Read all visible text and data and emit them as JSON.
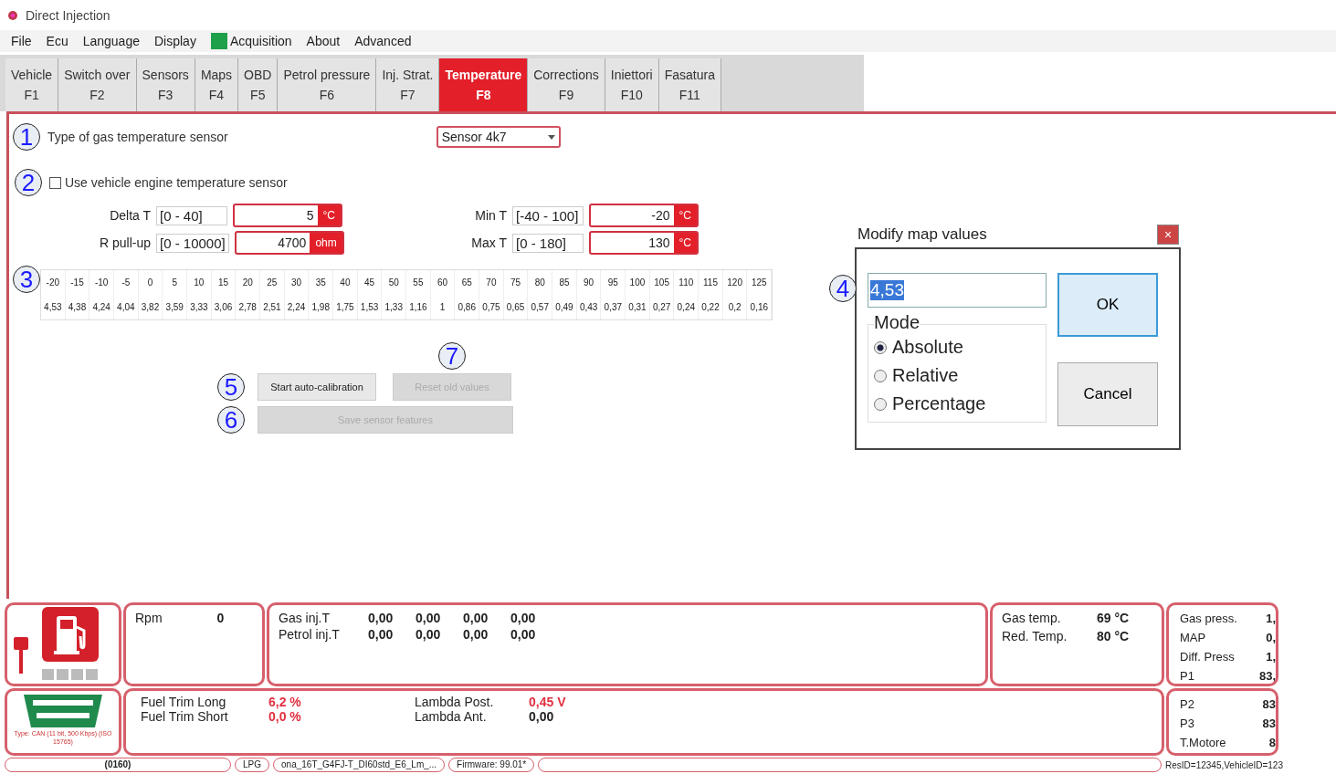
{
  "window": {
    "title": "Direct Injection"
  },
  "menu": [
    {
      "label": "File",
      "indicator": false
    },
    {
      "label": "Ecu",
      "indicator": false
    },
    {
      "label": "Language",
      "indicator": false
    },
    {
      "label": "Display",
      "indicator": false
    },
    {
      "label": "Acquisition",
      "indicator": true
    },
    {
      "label": "About",
      "indicator": false
    },
    {
      "label": "Advanced",
      "indicator": false
    }
  ],
  "tabs": [
    {
      "label": "Vehicle",
      "key": "F1",
      "selected": false
    },
    {
      "label": "Switch over",
      "key": "F2",
      "selected": false
    },
    {
      "label": "Sensors",
      "key": "F3",
      "selected": false
    },
    {
      "label": "Maps",
      "key": "F4",
      "selected": false
    },
    {
      "label": "OBD",
      "key": "F5",
      "selected": false
    },
    {
      "label": "Petrol pressure",
      "key": "F6",
      "selected": false
    },
    {
      "label": "Inj. Strat.",
      "key": "F7",
      "selected": false
    },
    {
      "label": "Temperature",
      "key": "F8",
      "selected": true
    },
    {
      "label": "Corrections",
      "key": "F9",
      "selected": false
    },
    {
      "label": "Iniettori",
      "key": "F10",
      "selected": false
    },
    {
      "label": "Fasatura",
      "key": "F11",
      "selected": false
    }
  ],
  "sensor_type": {
    "marker": "1",
    "label": "Type of gas temperature sensor",
    "value": "Sensor 4k7"
  },
  "engine_sensor": {
    "marker": "2",
    "label": "Use vehicle engine temperature sensor",
    "checked": false
  },
  "fields": [
    {
      "label": "Delta T",
      "range": "[0 - 40]",
      "value": "5",
      "unit": "°C"
    },
    {
      "label": "Min T",
      "range": "[-40 - 100]",
      "value": "-20",
      "unit": "°C"
    },
    {
      "label": "R pull-up",
      "range": "[0 - 10000]",
      "value": "4700",
      "unit": "ohm"
    },
    {
      "label": "Max T",
      "range": "[0 - 180]",
      "value": "130",
      "unit": "°C"
    }
  ],
  "table": {
    "marker": "3",
    "header": [
      "-20",
      "-15",
      "-10",
      "-5",
      "0",
      "5",
      "10",
      "15",
      "20",
      "25",
      "30",
      "35",
      "40",
      "45",
      "50",
      "55",
      "60",
      "65",
      "70",
      "75",
      "80",
      "85",
      "90",
      "95",
      "100",
      "105",
      "110",
      "115",
      "120",
      "125"
    ],
    "values": [
      "4,53",
      "4,38",
      "4,24",
      "4,04",
      "3,82",
      "3,59",
      "3,33",
      "3,06",
      "2,78",
      "2,51",
      "2,24",
      "1,98",
      "1,75",
      "1,53",
      "1,33",
      "1,16",
      "1",
      "0,86",
      "0,75",
      "0,65",
      "0,57",
      "0,49",
      "0,43",
      "0,37",
      "0,31",
      "0,27",
      "0,24",
      "0,22",
      "0,2",
      "0,16"
    ]
  },
  "buttons": [
    {
      "marker": "5",
      "label": "Start auto-calibration",
      "disabled": false
    },
    {
      "marker": "7",
      "label": "Reset old values",
      "disabled": true
    },
    {
      "marker": "6",
      "label": "Save sensor features",
      "disabled": true
    }
  ],
  "dialog": {
    "title": "Modify map values",
    "close": "×",
    "marker": "4",
    "value": "4,53",
    "ok": "OK",
    "cancel": "Cancel",
    "group": "Mode",
    "modes": [
      {
        "label": "Absolute",
        "selected": true
      },
      {
        "label": "Relative",
        "selected": false
      },
      {
        "label": "Percentage",
        "selected": false
      }
    ]
  },
  "dashboard": {
    "rpm": {
      "label": "Rpm",
      "value": "0"
    },
    "injection": [
      {
        "label": "Gas inj.T",
        "values": [
          "0,00",
          "0,00",
          "0,00",
          "0,00"
        ]
      },
      {
        "label": "Petrol inj.T",
        "values": [
          "0,00",
          "0,00",
          "0,00",
          "0,00"
        ]
      }
    ],
    "temps": [
      {
        "label": "Gas temp.",
        "value": "69 °C"
      },
      {
        "label": "Red. Temp.",
        "value": "80 °C"
      }
    ],
    "pressures": [
      {
        "label": "Gas press.",
        "value": "1,"
      },
      {
        "label": "MAP",
        "value": "0,"
      },
      {
        "label": "Diff. Press",
        "value": "1,"
      },
      {
        "label": "P1",
        "value": "83,"
      }
    ],
    "obd_caption": "Type: CAN (11 bit, 500 Kbps) (ISO 15765)",
    "trims": [
      {
        "label": "Fuel Trim Long",
        "value": "6,2 %",
        "alert": true
      },
      {
        "label": "Lambda Post.",
        "value": "0,45 V",
        "alert": true
      },
      {
        "label": "Fuel Trim Short",
        "value": "0,0 %",
        "alert": true
      },
      {
        "label": "Lambda Ant.",
        "value": "0,00",
        "alert": false
      }
    ],
    "pressures2": [
      {
        "label": "P2",
        "value": "83"
      },
      {
        "label": "P3",
        "value": "83"
      },
      {
        "label": "T.Motore",
        "value": "8"
      }
    ]
  },
  "status_bar": [
    "(0160)",
    "LPG",
    "ona_16T_G4FJ-T_DI60std_E6_Lm_...",
    "Firmware: 99.01*"
  ],
  "status_right": "ResID=12345,VehicleID=123"
}
